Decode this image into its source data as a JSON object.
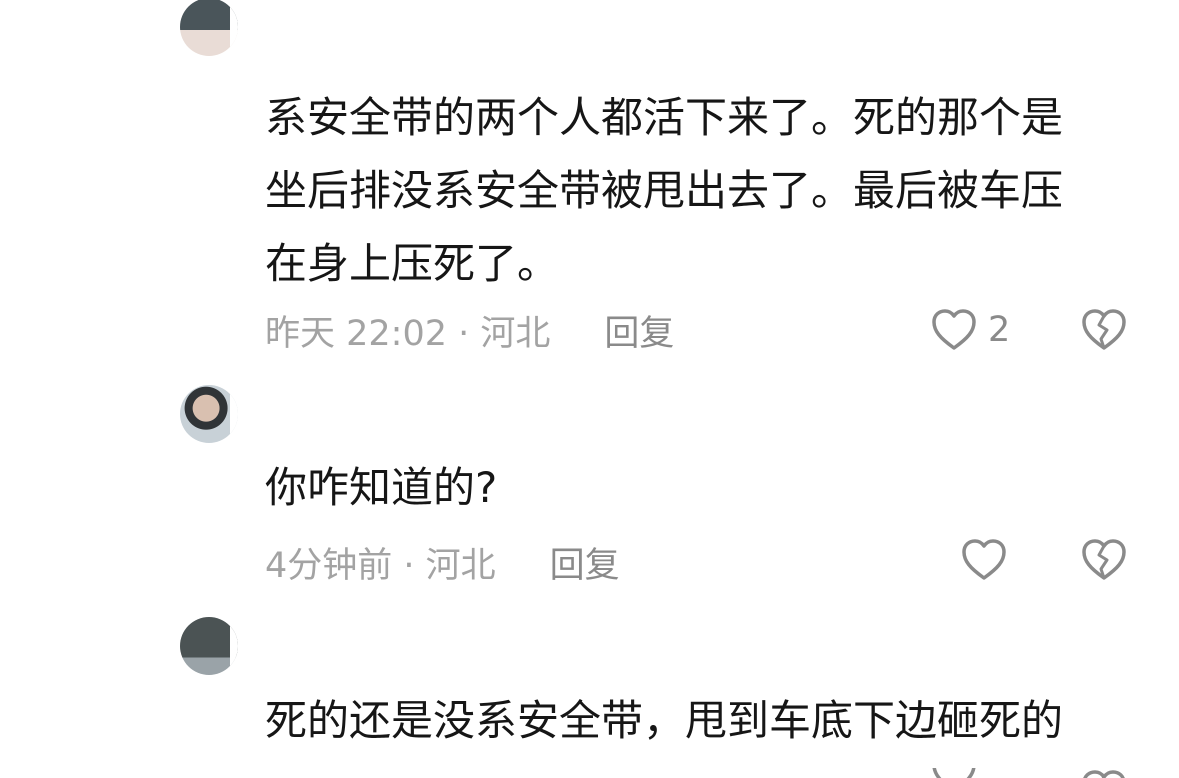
{
  "comments": [
    {
      "username": "",
      "text": "系安全带的两个人都活下来了。死的那个是\n坐后排没系安全带被甩出去了。最后被车压\n在身上压死了。",
      "time_location": "昨天 22:02 · 河北",
      "reply_label": "回复",
      "like_count": "2"
    },
    {
      "username": "",
      "text": "你咋知道的?",
      "time_location": "4分钟前 · 河北",
      "reply_label": "回复",
      "like_count": ""
    },
    {
      "username": "",
      "text": "死的还是没系安全带，甩到车底下边砸死的",
      "time_location": "",
      "reply_label": "",
      "like_count": ""
    }
  ],
  "icons": {
    "like": "heart-outline-icon",
    "dislike": "broken-heart-icon"
  },
  "colors": {
    "text": "#161616",
    "meta": "#a3a3a3",
    "icon": "#8a8a8a",
    "background": "#ffffff"
  }
}
